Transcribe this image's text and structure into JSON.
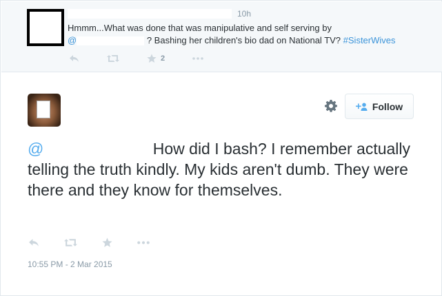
{
  "parent_tweet": {
    "time": "10h",
    "text_before": "Hmmm...What was done that was manipulative and self serving by",
    "mention_prefix": "@",
    "text_after": "?  Bashing her children's bio dad on National TV?",
    "hashtag": "#SisterWives",
    "actions": [
      {
        "name": "reply",
        "icon": "reply-icon"
      },
      {
        "name": "retweet",
        "icon": "retweet-icon"
      },
      {
        "name": "favorite",
        "icon": "star-icon",
        "count": "2"
      },
      {
        "name": "more",
        "icon": "more-icon"
      }
    ]
  },
  "main_tweet": {
    "follow_label": "Follow",
    "mention_prefix": "@",
    "text": "How did I bash? I remember actually telling the truth kindly.  My kids aren't dumb. They were there and they know for themselves.",
    "timestamp": "10:55 PM - 2 Mar 2015",
    "actions": [
      {
        "name": "reply",
        "icon": "reply-icon"
      },
      {
        "name": "retweet",
        "icon": "retweet-icon"
      },
      {
        "name": "favorite",
        "icon": "star-icon"
      },
      {
        "name": "more",
        "icon": "more-icon"
      }
    ]
  },
  "colors": {
    "link": "#55acee",
    "muted": "#8899a6",
    "icon": "#ccd6dd",
    "parent_bg": "#f5f8fa"
  }
}
